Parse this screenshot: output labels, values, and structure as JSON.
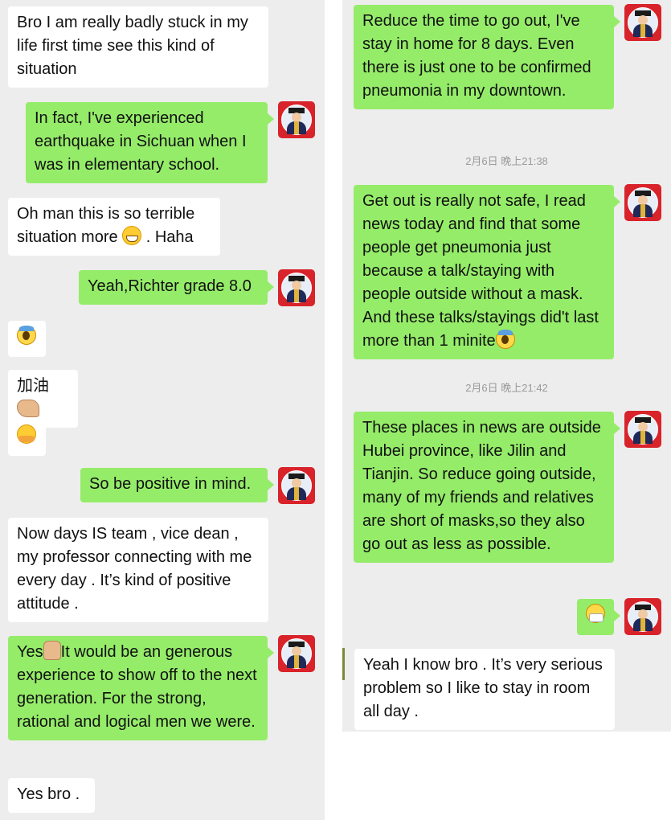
{
  "left_chat": {
    "m1": "Bro I am really badly stuck in my life first time see this kind of situation",
    "m2": "In fact, I've experienced earthquake in Sichuan when I was in elementary school.",
    "m3": "Oh man this is so terrible situation more",
    "m3_tail": ". Haha",
    "m4": "Yeah,Richter grade 8.0",
    "m6": "加油",
    "m8": "So be positive in mind.",
    "m9": "Now days IS team , vice dean , my professor connecting with me every day . It’s kind of positive attitude .",
    "m10_a": "Yes",
    "m10_b": "It would be an generous experience to show off to the next generation. For the strong, rational and logical men we were.",
    "m11": "Yes bro ."
  },
  "right_chat": {
    "r1": "Reduce the time to go out, I've stay in home for 8 days. Even there is just one to be confirmed pneumonia in my downtown.",
    "ts1": "2月6日 晚上21:38",
    "r2": "Get out is really not safe, I read news today and find that some people get pneumonia just because a talk/staying with people outside without a mask. And these talks/stayings did't last more than 1 minite",
    "ts2": "2月6日 晚上21:42",
    "r3": "These places in news are outside Hubei province, like Jilin and Tianjin. So reduce going outside, many of my friends and relatives are short of masks,so they also go out as less as possible.",
    "r5": "Yeah I know bro . It’s very serious problem so I like to stay in room all day ."
  },
  "icons": {
    "grin": "grinning-face-icon",
    "scream": "screaming-face-icon",
    "hug": "hugging-face-icon",
    "muscle": "flexed-biceps-icon",
    "thumb": "thumbs-up-icon",
    "mask": "face-with-mask-icon"
  },
  "colors": {
    "background": "#ededed",
    "incoming": "#ffffff",
    "outgoing": "#95ec69",
    "avatar_frame": "#d8232a"
  }
}
